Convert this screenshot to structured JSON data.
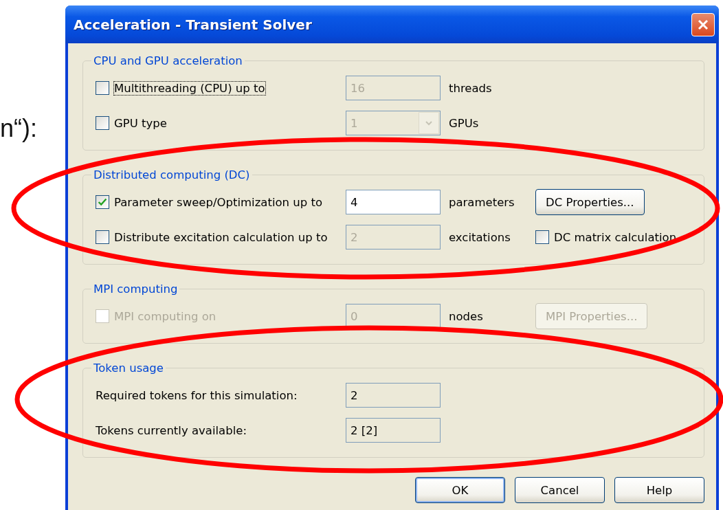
{
  "slide_text": "n“):",
  "dialog": {
    "title": "Acceleration - Transient Solver",
    "groups": [
      {
        "title": "CPU and GPU acceleration",
        "rows": [
          {
            "kind": "option",
            "label": "Multithreading (CPU) up to",
            "checked": false,
            "disabled": false,
            "focused": true,
            "field": {
              "value": "16",
              "disabled": true,
              "dropdown": false
            },
            "unit": "threads"
          },
          {
            "kind": "option",
            "label": "GPU type",
            "checked": false,
            "disabled": false,
            "focused": false,
            "field": {
              "value": "1",
              "disabled": true,
              "dropdown": true
            },
            "unit": "GPUs"
          }
        ]
      },
      {
        "title": "Distributed computing (DC)",
        "rows": [
          {
            "kind": "option",
            "label": "Parameter sweep/Optimization up to",
            "checked": true,
            "disabled": false,
            "focused": false,
            "field": {
              "value": "4",
              "disabled": false,
              "dropdown": false
            },
            "unit": "parameters",
            "button": {
              "label": "DC Properties...",
              "disabled": false
            }
          },
          {
            "kind": "option",
            "label": "Distribute excitation calculation up to",
            "checked": false,
            "disabled": false,
            "focused": false,
            "field": {
              "value": "2",
              "disabled": true,
              "dropdown": false
            },
            "unit": "excitations",
            "extra_option": {
              "label": "DC matrix calculation",
              "checked": false
            }
          }
        ]
      },
      {
        "title": "MPI computing",
        "rows": [
          {
            "kind": "option",
            "label": "MPI computing on",
            "checked": false,
            "disabled": true,
            "focused": false,
            "field": {
              "value": "0",
              "disabled": true,
              "dropdown": false
            },
            "unit": "nodes",
            "button": {
              "label": "MPI Properties...",
              "disabled": true
            }
          }
        ]
      },
      {
        "title": "Token usage",
        "rows": [
          {
            "kind": "info",
            "label": "Required tokens for this simulation:",
            "value": "2"
          },
          {
            "kind": "info",
            "label": "Tokens currently available:",
            "value": "2 [2]"
          }
        ]
      }
    ],
    "buttons": [
      {
        "label": "OK",
        "default": true
      },
      {
        "label": "Cancel",
        "default": false
      },
      {
        "label": "Help",
        "default": false
      }
    ]
  },
  "annotations": [
    {
      "kind": "ellipse"
    },
    {
      "kind": "ellipse"
    }
  ]
}
